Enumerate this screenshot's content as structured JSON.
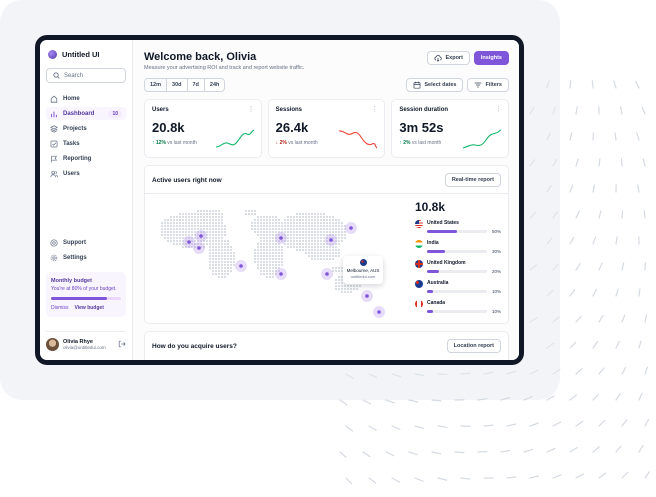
{
  "app": {
    "name": "Untitled UI"
  },
  "sidebar": {
    "search_placeholder": "Search",
    "items": [
      {
        "label": "Home",
        "icon": "home-icon"
      },
      {
        "label": "Dashboard",
        "icon": "bar-chart-icon",
        "badge": "10",
        "active": true
      },
      {
        "label": "Projects",
        "icon": "layers-icon"
      },
      {
        "label": "Tasks",
        "icon": "check-square-icon"
      },
      {
        "label": "Reporting",
        "icon": "flag-icon"
      },
      {
        "label": "Users",
        "icon": "users-icon"
      }
    ],
    "bottom_items": [
      {
        "label": "Support",
        "icon": "life-buoy-icon"
      },
      {
        "label": "Settings",
        "icon": "gear-icon"
      }
    ],
    "budget": {
      "title": "Monthly budget",
      "text": "You're at 80% of your budget.",
      "progress": 0.8,
      "dismiss": "Dismiss",
      "view": "View budget"
    },
    "user": {
      "name": "Olivia Rhye",
      "email": "olivia@untitledui.com"
    }
  },
  "header": {
    "title": "Welcome back, Olivia",
    "subtitle": "Measure your advertising ROI and track and report website traffic.",
    "export_label": "Export",
    "insights_label": "Insights"
  },
  "toolbar": {
    "ranges": [
      "12m",
      "30d",
      "7d",
      "24h"
    ],
    "select_dates": "Select dates",
    "filters": "Filters"
  },
  "stats": [
    {
      "label": "Users",
      "value": "20.8k",
      "change": "12%",
      "direction": "up",
      "suffix": "vs last month"
    },
    {
      "label": "Sessions",
      "value": "26.4k",
      "change": "2%",
      "direction": "down",
      "suffix": "vs last month"
    },
    {
      "label": "Session duration",
      "value": "3m 52s",
      "change": "2%",
      "direction": "up",
      "suffix": "vs last month"
    }
  ],
  "active_users": {
    "title": "Active users right now",
    "button": "Real-time report",
    "total": "10.8k",
    "countries": [
      {
        "name": "United States",
        "percent": 50,
        "label": "50%"
      },
      {
        "name": "India",
        "percent": 30,
        "label": "30%"
      },
      {
        "name": "United Kingdom",
        "percent": 20,
        "label": "20%"
      },
      {
        "name": "Australia",
        "percent": 10,
        "label": "10%"
      },
      {
        "name": "Canada",
        "percent": 10,
        "label": "10%"
      }
    ],
    "tooltip": {
      "city": "Melbourne, AUS",
      "site": "untitledui.com"
    }
  },
  "acquire": {
    "title": "How do you acquire users?",
    "button": "Location report"
  },
  "colors": {
    "accent": "#7f56d9",
    "up": "#12b76a",
    "down": "#f04438"
  }
}
